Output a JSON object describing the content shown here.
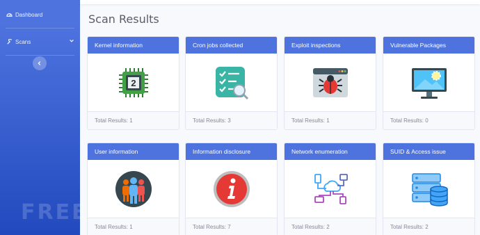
{
  "sidebar": {
    "dashboard_label": "Dashboard",
    "scans_label": "Scans",
    "toggle_icon": "chevron-left-icon",
    "watermark": "FREEBUF"
  },
  "page": {
    "title": "Scan Results"
  },
  "cards": [
    {
      "title": "Kernel information",
      "footer": "Total Results: 1",
      "icon": "cpu-chip-icon"
    },
    {
      "title": "Cron jobs collected",
      "footer": "Total Results: 3",
      "icon": "checklist-search-icon"
    },
    {
      "title": "Exploit inspections",
      "footer": "Total Results: 1",
      "icon": "browser-bug-icon"
    },
    {
      "title": "Vulnerable Packages",
      "footer": "Total Results: 0",
      "icon": "monitor-gear-icon"
    },
    {
      "title": "User information",
      "footer": "Total Results: 1",
      "icon": "users-group-icon"
    },
    {
      "title": "Information disclosure",
      "footer": "Total Results: 7",
      "icon": "info-circle-icon"
    },
    {
      "title": "Network enumeration",
      "footer": "Total Results: 2",
      "icon": "network-cloud-icon"
    },
    {
      "title": "SUID & Access issue",
      "footer": "Total Results: 2",
      "icon": "server-database-icon"
    }
  ],
  "colors": {
    "primary": "#4e73df",
    "sidebar_bottom": "#224abe",
    "text_muted": "#858796"
  }
}
